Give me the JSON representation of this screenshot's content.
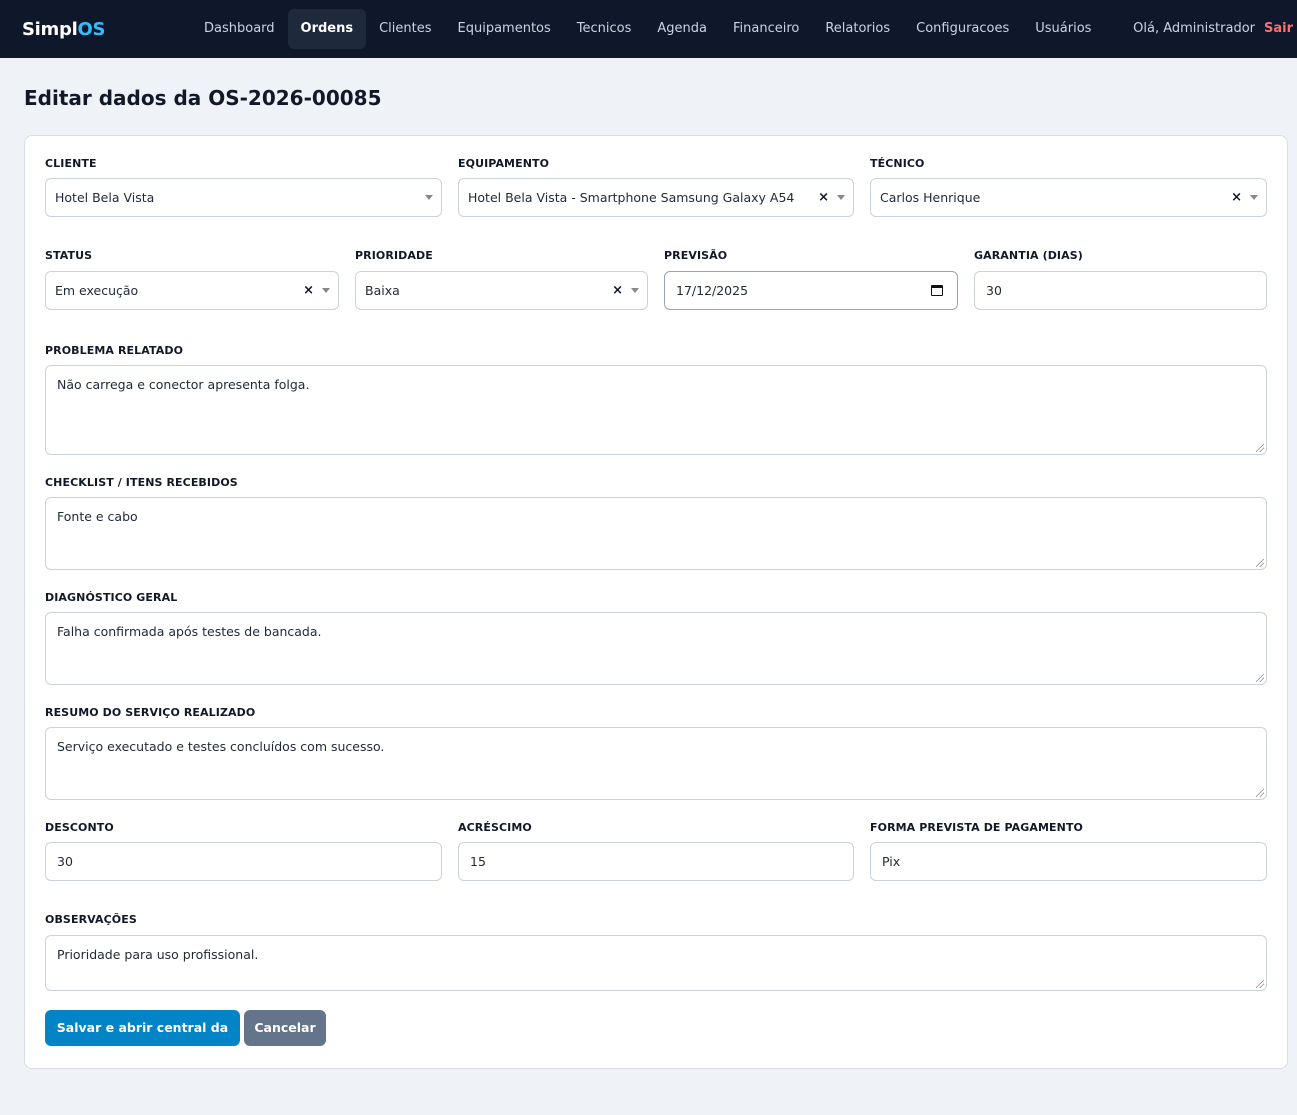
{
  "app": {
    "logo_text": "Simpl",
    "logo_accent": "OS"
  },
  "nav": {
    "items": [
      {
        "label": "Dashboard",
        "active": false
      },
      {
        "label": "Ordens",
        "active": true
      },
      {
        "label": "Clientes",
        "active": false
      },
      {
        "label": "Equipamentos",
        "active": false
      },
      {
        "label": "Tecnicos",
        "active": false
      },
      {
        "label": "Agenda",
        "active": false
      },
      {
        "label": "Financeiro",
        "active": false
      },
      {
        "label": "Relatorios",
        "active": false
      },
      {
        "label": "Configuracoes",
        "active": false
      },
      {
        "label": "Usuários",
        "active": false
      }
    ],
    "greeting": "Olá, Administrador",
    "logout": "Sair"
  },
  "page": {
    "title": "Editar dados da OS-2026-00085"
  },
  "form": {
    "cliente": {
      "label": "CLIENTE",
      "value": "Hotel Bela Vista"
    },
    "equipamento": {
      "label": "EQUIPAMENTO",
      "value": "Hotel Bela Vista - Smartphone Samsung Galaxy A54"
    },
    "tecnico": {
      "label": "TÉCNICO",
      "value": "Carlos Henrique"
    },
    "status": {
      "label": "STATUS",
      "value": "Em execução"
    },
    "prioridade": {
      "label": "PRIORIDADE",
      "value": "Baixa"
    },
    "previsao": {
      "label": "PREVISÃO",
      "value": "17/12/2025"
    },
    "garantia": {
      "label": "GARANTIA (DIAS)",
      "value": "30"
    },
    "problema": {
      "label": "PROBLEMA RELATADO",
      "value": "Não carrega e conector apresenta folga."
    },
    "checklist": {
      "label": "CHECKLIST / ITENS RECEBIDOS",
      "value": "Fonte e cabo"
    },
    "diagnostico": {
      "label": "DIAGNÓSTICO GERAL",
      "value": "Falha confirmada após testes de bancada."
    },
    "resumo": {
      "label": "RESUMO DO SERVIÇO REALIZADO",
      "value": "Serviço executado e testes concluídos com sucesso."
    },
    "desconto": {
      "label": "DESCONTO",
      "value": "30"
    },
    "acrescimo": {
      "label": "ACRÉSCIMO",
      "value": "15"
    },
    "pagamento": {
      "label": "FORMA PREVISTA DE PAGAMENTO",
      "value": "Pix"
    },
    "observacoes": {
      "label": "OBSERVAÇÕES",
      "value": "Prioridade para uso profissional."
    },
    "clear_symbol": "×"
  },
  "actions": {
    "save_label": "Salvar e abrir central da OS",
    "cancel_label": "Cancelar"
  },
  "colors": {
    "topbar": "#0f172a",
    "accent": "#38bdf8",
    "primary_button": "#0284c7",
    "secondary_button": "#64748b",
    "logout": "#f87171"
  }
}
